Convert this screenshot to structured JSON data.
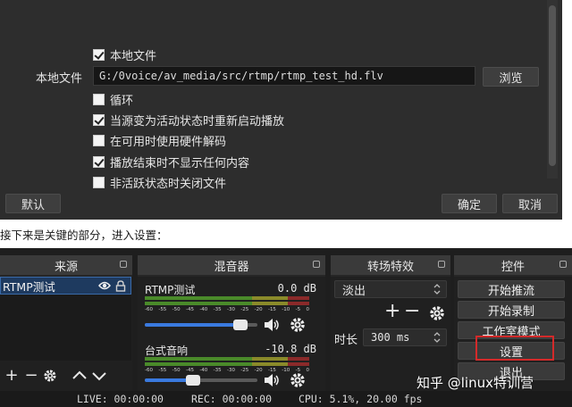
{
  "dialog": {
    "file_label": "本地文件",
    "file_path": "G:/0voice/av_media/src/rtmp/rtmp_test_hd.flv",
    "browse_label": "浏览",
    "options": [
      {
        "label": "本地文件",
        "checked": true
      },
      {
        "label": "循环",
        "checked": false
      },
      {
        "label": "当源变为活动状态时重新启动播放",
        "checked": true
      },
      {
        "label": "在可用时使用硬件解码",
        "checked": false
      },
      {
        "label": "播放结束时不显示任何内容",
        "checked": true
      },
      {
        "label": "非活跃状态时关闭文件",
        "checked": false
      }
    ],
    "defaults_label": "默认",
    "ok_label": "确定",
    "cancel_label": "取消"
  },
  "caption": "接下来是关键的部分，进入设置：",
  "obs": {
    "sources": {
      "title": "来源",
      "items": [
        {
          "name": "RTMP测试",
          "selected": true
        }
      ]
    },
    "mixer": {
      "title": "混音器",
      "ticks": [
        "-60",
        "-55",
        "-50",
        "-45",
        "-40",
        "-35",
        "-30",
        "-25",
        "-20",
        "-15",
        "-10",
        "-5",
        "0"
      ],
      "channels": [
        {
          "name": "RTMP测试",
          "db": "0.0 dB",
          "volume": 0.85,
          "level": 0.0
        },
        {
          "name": "台式音响",
          "db": "-10.8 dB",
          "volume": 0.43,
          "level": 0.0
        }
      ]
    },
    "transitions": {
      "title": "转场特效",
      "selected": "淡出",
      "duration_label": "时长",
      "duration_value": "300 ms"
    },
    "controls": {
      "title": "控件",
      "buttons": [
        "开始推流",
        "开始录制",
        "工作室模式",
        "设置",
        "退出"
      ]
    },
    "status": {
      "live": "LIVE: 00:00:00",
      "rec": "REC: 00:00:00",
      "cpu": "CPU: 5.1%, 20.00 fps"
    }
  },
  "watermark": "知乎 @linux特训营",
  "colors": {
    "accent_blue": "#3a7adf",
    "highlight_red": "#d42a2a",
    "meter_green": "#4a8a2a"
  }
}
